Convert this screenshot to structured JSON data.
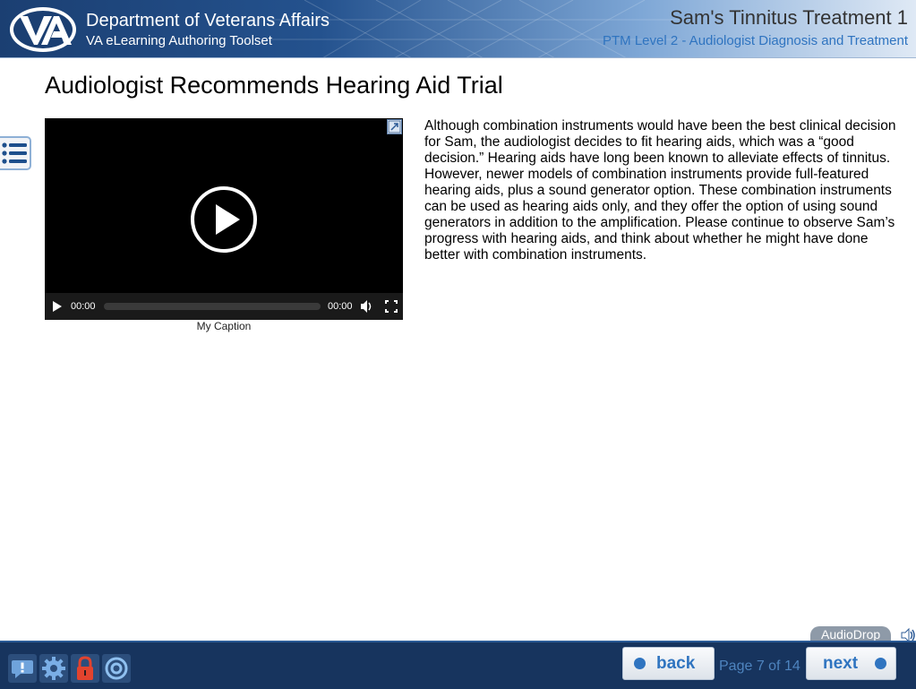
{
  "header": {
    "department": "Department of Veterans Affairs",
    "toolset": "VA eLearning Authoring Toolset",
    "course_title": "Sam's Tinnitus Treatment 1",
    "course_subtitle": "PTM Level 2 - Audiologist Diagnosis and Treatment"
  },
  "page": {
    "title": "Audiologist Recommends Hearing Aid Trial",
    "body": "Although combination instruments would have been the best clinical decision for Sam, the audiologist decides to fit hearing aids, which was a “good decision.” Hearing aids have long been known to alleviate effects of tinnitus. However, newer models of combination instruments provide full-featured hearing aids, plus a sound generator option. These combination instruments can be used as hearing aids only, and they offer the option of using sound generators in addition to the amplification. Please continue to observe Sam’s progress with hearing aids, and think about whether he might have done better with combination instruments."
  },
  "video": {
    "current_time": "00:00",
    "duration": "00:00",
    "caption": "My Caption",
    "progress": 0
  },
  "audiodrop": {
    "label": "AudioDrop"
  },
  "footer": {
    "back_label": "back",
    "next_label": "next",
    "page_indicator": "Page 7 of 14"
  },
  "icons": [
    "menu-list-icon",
    "play-icon",
    "popout-icon",
    "volume-icon",
    "fullscreen-icon",
    "help-icon",
    "settings-icon",
    "lock-icon",
    "target-icon",
    "speaker-icon"
  ],
  "colors": {
    "header_dark": "#1b3f72",
    "footer": "#17345e",
    "accent": "#2f74c0"
  }
}
